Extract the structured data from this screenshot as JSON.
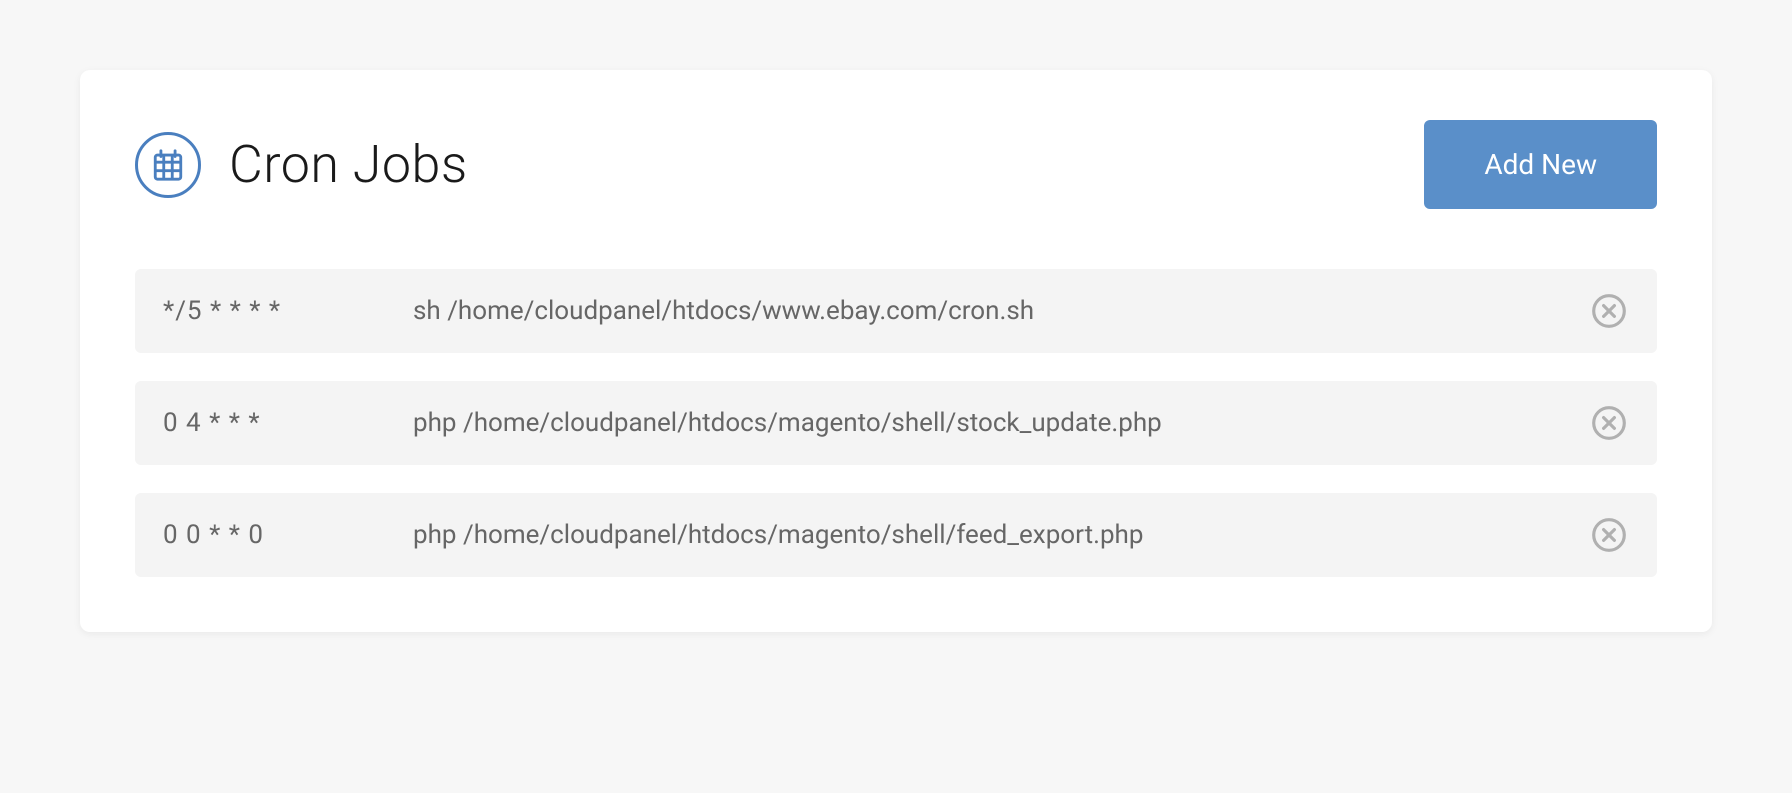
{
  "header": {
    "title": "Cron Jobs",
    "add_button_label": "Add New"
  },
  "jobs": [
    {
      "schedule": "*/5 * * * *",
      "command": "sh /home/cloudpanel/htdocs/www.ebay.com/cron.sh"
    },
    {
      "schedule": "0 4 * * *",
      "command": "php /home/cloudpanel/htdocs/magento/shell/stock_update.php"
    },
    {
      "schedule": "0 0 * * 0",
      "command": "php /home/cloudpanel/htdocs/magento/shell/feed_export.php"
    }
  ]
}
